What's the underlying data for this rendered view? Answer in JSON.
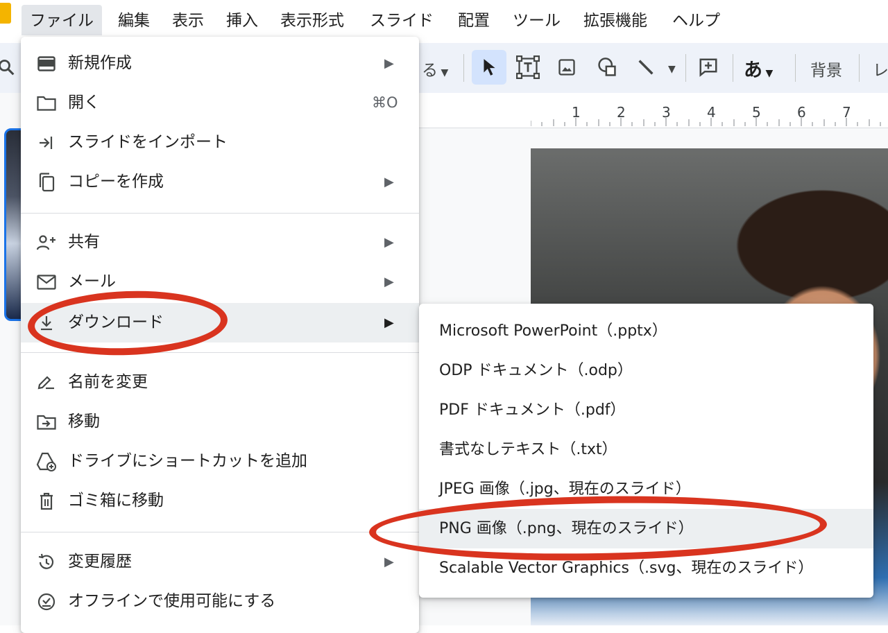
{
  "menubar": {
    "items": [
      "ファイル",
      "編集",
      "表示",
      "挿入",
      "表示形式",
      "スライド",
      "配置",
      "ツール",
      "拡張機能",
      "ヘルプ"
    ],
    "active_index": 0
  },
  "toolbar": {
    "partial_label": "る",
    "background_label": "背景",
    "layout_label_partial": "レ",
    "text_style_label": "あ"
  },
  "ruler": {
    "numbers": [
      "1",
      "2",
      "3",
      "4",
      "5",
      "6",
      "7"
    ]
  },
  "file_menu": {
    "new": "新規作成",
    "open": "開く",
    "open_shortcut": "⌘O",
    "import_slides": "スライドをインポート",
    "make_copy": "コピーを作成",
    "share": "共有",
    "email": "メール",
    "download": "ダウンロード",
    "rename": "名前を変更",
    "move": "移動",
    "add_shortcut": "ドライブにショートカットを追加",
    "trash": "ゴミ箱に移動",
    "version_history": "変更履歴",
    "offline": "オフラインで使用可能にする"
  },
  "download_submenu": {
    "items": [
      "Microsoft PowerPoint（.pptx）",
      "ODP ドキュメント（.odp）",
      "PDF ドキュメント（.pdf）",
      "書式なしテキスト（.txt）",
      "JPEG 画像（.jpg、現在のスライド）",
      "PNG 画像（.png、現在のスライド）",
      "Scalable Vector Graphics（.svg、現在のスライド）"
    ],
    "highlighted_index": 5
  },
  "colors": {
    "annotation_red": "#d9341f",
    "selection_blue": "#d3e3fd",
    "toolbar_bg": "#eef2f9",
    "menu_highlight": "#eceff1"
  }
}
